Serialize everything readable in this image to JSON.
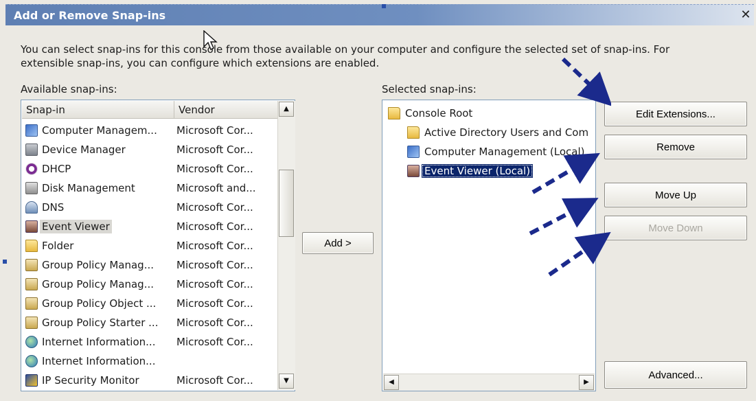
{
  "dialog": {
    "title": "Add or Remove Snap-ins",
    "close_symbol": "✕",
    "description_line1": "You can select snap-ins for this console from those available on your computer and configure the selected set of snap-ins. For",
    "description_line2": "extensible snap-ins, you can configure which extensions are enabled."
  },
  "available": {
    "label": "Available snap-ins:",
    "columns": {
      "snapin": "Snap-in",
      "vendor": "Vendor"
    },
    "rows": [
      {
        "name": "Computer Managem...",
        "vendor": "Microsoft Cor...",
        "icon": "computer-management-icon"
      },
      {
        "name": "Device Manager",
        "vendor": "Microsoft Cor...",
        "icon": "device-manager-icon"
      },
      {
        "name": "DHCP",
        "vendor": "Microsoft Cor...",
        "icon": "dhcp-icon"
      },
      {
        "name": "Disk Management",
        "vendor": "Microsoft and...",
        "icon": "disk-management-icon"
      },
      {
        "name": "DNS",
        "vendor": "Microsoft Cor...",
        "icon": "dns-icon"
      },
      {
        "name": "Event Viewer",
        "vendor": "Microsoft Cor...",
        "icon": "event-viewer-icon"
      },
      {
        "name": "Folder",
        "vendor": "Microsoft Cor...",
        "icon": "folder-icon"
      },
      {
        "name": "Group Policy Manag...",
        "vendor": "Microsoft Cor...",
        "icon": "group-policy-icon"
      },
      {
        "name": "Group Policy Manag...",
        "vendor": "Microsoft Cor...",
        "icon": "group-policy-icon"
      },
      {
        "name": "Group Policy Object ...",
        "vendor": "Microsoft Cor...",
        "icon": "group-policy-icon"
      },
      {
        "name": "Group Policy Starter ...",
        "vendor": "Microsoft Cor...",
        "icon": "group-policy-icon"
      },
      {
        "name": "Internet Information...",
        "vendor": "Microsoft Cor...",
        "icon": "iis-icon"
      },
      {
        "name": "Internet Information...",
        "vendor": "",
        "icon": "iis-icon"
      },
      {
        "name": "IP Security Monitor",
        "vendor": "Microsoft Cor...",
        "icon": "ip-security-icon"
      }
    ]
  },
  "add_button": "Add >",
  "selected": {
    "label": "Selected snap-ins:",
    "tree": [
      {
        "name": "Console Root",
        "icon": "folder-icon"
      },
      {
        "name": "Active Directory Users and Com",
        "icon": "active-directory-icon"
      },
      {
        "name": "Computer Management (Local)",
        "icon": "computer-management-icon"
      },
      {
        "name": "Event Viewer (Local)",
        "icon": "event-viewer-icon"
      }
    ]
  },
  "buttons": {
    "edit_extensions": "Edit Extensions...",
    "remove": "Remove",
    "move_up": "Move Up",
    "move_down": "Move Down",
    "advanced": "Advanced..."
  },
  "scroll_glyphs": {
    "up": "▲",
    "down": "▼",
    "left": "◀",
    "right": "▶"
  },
  "colors": {
    "titlebar": "#5e7fb3",
    "selection": "#0a246a",
    "arrow_annotation": "#1b2a8c"
  }
}
